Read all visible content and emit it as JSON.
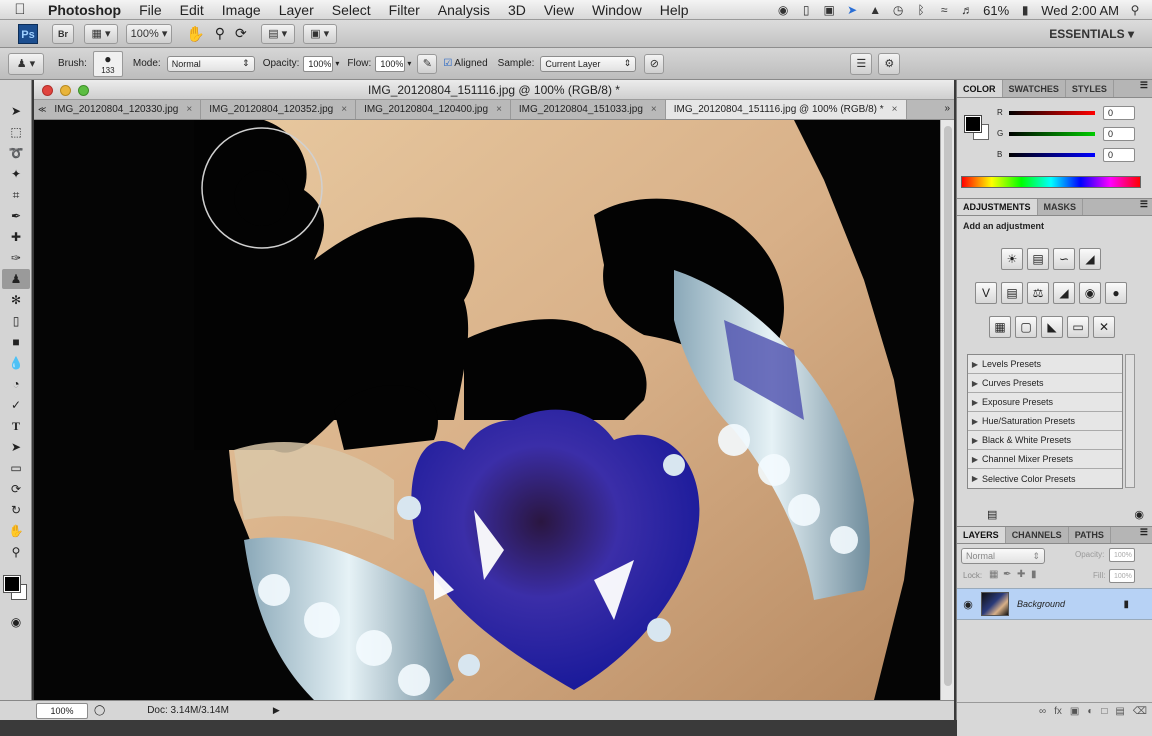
{
  "menubar": {
    "app": "Photoshop",
    "items": [
      "File",
      "Edit",
      "Image",
      "Layer",
      "Select",
      "Filter",
      "Analysis",
      "3D",
      "View",
      "Window",
      "Help"
    ],
    "battery": "61%",
    "clock": "Wed 2:00 AM"
  },
  "appbar": {
    "logo": "Ps",
    "bridge": "Br",
    "zoom": "100%",
    "workspace": "ESSENTIALS ▾"
  },
  "options": {
    "brush_label": "Brush:",
    "brush_size": "133",
    "mode_label": "Mode:",
    "mode_value": "Normal",
    "opacity_label": "Opacity:",
    "opacity_value": "100%",
    "flow_label": "Flow:",
    "flow_value": "100%",
    "aligned_label": "Aligned",
    "sample_label": "Sample:",
    "sample_value": "Current Layer"
  },
  "document": {
    "title": "IMG_20120804_151116.jpg @ 100% (RGB/8) *",
    "tabs": [
      {
        "label": "IMG_20120804_120330.jpg"
      },
      {
        "label": "IMG_20120804_120352.jpg"
      },
      {
        "label": "IMG_20120804_120400.jpg"
      },
      {
        "label": "IMG_20120804_151033.jpg"
      },
      {
        "label": "IMG_20120804_151116.jpg @ 100% (RGB/8) *"
      }
    ]
  },
  "status": {
    "zoom": "100%",
    "doc": "Doc: 3.14M/3.14M"
  },
  "color_panel": {
    "tabs": [
      "COLOR",
      "SWATCHES",
      "STYLES"
    ],
    "r": "0",
    "g": "0",
    "b": "0",
    "r_label": "R",
    "g_label": "G",
    "b_label": "B"
  },
  "adjustments": {
    "tabs": [
      "ADJUSTMENTS",
      "MASKS"
    ],
    "heading": "Add an adjustment",
    "presets": [
      "Levels Presets",
      "Curves Presets",
      "Exposure Presets",
      "Hue/Saturation Presets",
      "Black & White Presets",
      "Channel Mixer Presets",
      "Selective Color Presets"
    ]
  },
  "layers": {
    "tabs": [
      "LAYERS",
      "CHANNELS",
      "PATHS"
    ],
    "blend": "Normal",
    "opacity_label": "Opacity:",
    "opacity_value": "100%",
    "lock_label": "Lock:",
    "fill_label": "Fill:",
    "fill_value": "100%",
    "layer_name": "Background"
  }
}
